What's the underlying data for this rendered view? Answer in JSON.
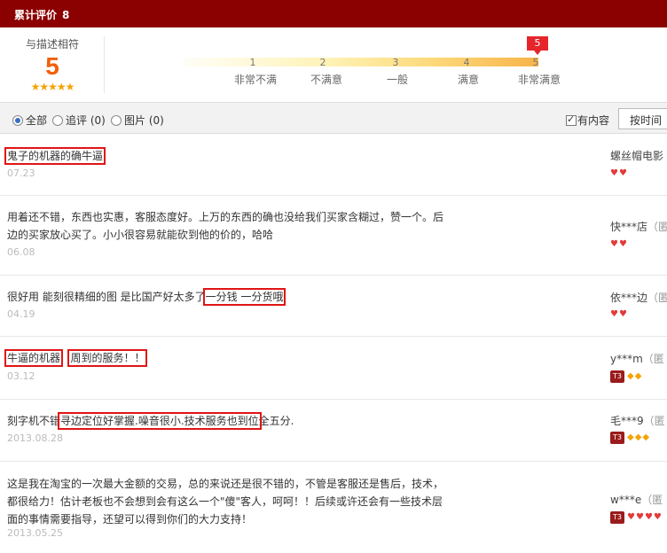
{
  "header": {
    "title": "累计评价",
    "count": "8"
  },
  "summary": {
    "match_label": "与描述相符",
    "score": "5",
    "stars": "★★★★★",
    "marker": "5",
    "scale": [
      {
        "num": "1",
        "label": "非常不满"
      },
      {
        "num": "2",
        "label": "不满意"
      },
      {
        "num": "3",
        "label": "一般"
      },
      {
        "num": "4",
        "label": "满意"
      },
      {
        "num": "5",
        "label": "非常满意"
      }
    ]
  },
  "filters": {
    "all": "全部",
    "followup": "追评 (0)",
    "images": "图片 (0)",
    "has_content": "有内容",
    "sort": "按时间"
  },
  "reviews": [
    {
      "text_a": "鬼子的机器的确牛逼",
      "date": "07.23",
      "user": "螺丝帽电影",
      "anon": ""
    },
    {
      "text_a": "用着还不错，东西也实惠，客服态度好。上万的东西的确也没给我们买家含糊过，赞一个。后边的买家放心买了。小小很容易就能砍到他的价的，哈哈",
      "date": "06.08",
      "user": "快***店",
      "anon": "（匿"
    },
    {
      "text_a": "很好用 能刻很精细的图 是比国产好太多了",
      "text_b": "一分钱 一分货哦",
      "date": "04.19",
      "user": "依***边",
      "anon": "（匿"
    },
    {
      "text_a": "牛逼的机器",
      "text_b": "周到的服务！！",
      "date": "03.12",
      "user": "y***m",
      "anon": "（匿"
    },
    {
      "text_a": "刻字机不错",
      "text_b": "寻边定位好掌握.噪音很小.技术服务也到位",
      "text_c": "全五分.",
      "date": "2013.08.28",
      "user": "毛***9",
      "anon": "（匿"
    },
    {
      "text_a": "这是我在淘宝的一次最大金额的交易，总的来说还是很不错的，不管是客服还是售后，技术，都很给力！估计老板也不会想到会有这么一个\"傻\"客人，呵呵！！后续或许还会有一些技术层面的事情需要指导，还望可以得到你们的大力支持！",
      "date": "2013.05.25",
      "user": "w***e",
      "anon": "（匿"
    }
  ]
}
